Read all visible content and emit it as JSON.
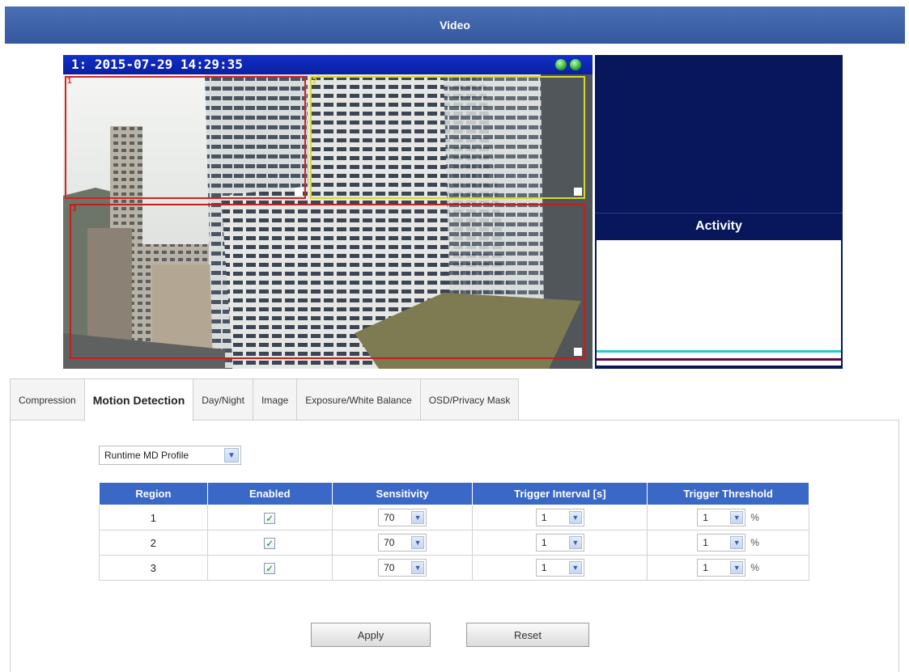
{
  "header": {
    "title": "Video"
  },
  "video": {
    "channel": "1:",
    "timestamp": "2015-07-29 14:29:35",
    "regions": [
      {
        "label": "1",
        "color": "#d32323"
      },
      {
        "label": "2",
        "color": "#d8d82a"
      },
      {
        "label": "3",
        "color": "#c41f1f"
      }
    ]
  },
  "activity": {
    "title": "Activity",
    "line_colors": [
      "#2fc8c8",
      "#5b0e3a"
    ]
  },
  "tabs": [
    {
      "label": "Compression"
    },
    {
      "label": "Motion Detection"
    },
    {
      "label": "Day/Night"
    },
    {
      "label": "Image"
    },
    {
      "label": "Exposure/White Balance"
    },
    {
      "label": "OSD/Privacy Mask"
    }
  ],
  "active_tab": "Motion Detection",
  "profile_select": {
    "value": "Runtime MD Profile"
  },
  "table": {
    "headers": [
      "Region",
      "Enabled",
      "Sensitivity",
      "Trigger Interval [s]",
      "Trigger Threshold"
    ],
    "rows": [
      {
        "region": "1",
        "enabled": true,
        "sensitivity": "70",
        "interval": "1",
        "threshold": "1",
        "unit": "%"
      },
      {
        "region": "2",
        "enabled": true,
        "sensitivity": "70",
        "interval": "1",
        "threshold": "1",
        "unit": "%"
      },
      {
        "region": "3",
        "enabled": true,
        "sensitivity": "70",
        "interval": "1",
        "threshold": "1",
        "unit": "%"
      }
    ]
  },
  "buttons": {
    "apply": "Apply",
    "reset": "Reset"
  },
  "colors": {
    "header_blue": "#3a5fa8",
    "table_header": "#3a68c7",
    "video_bar": "#0f27b8"
  }
}
